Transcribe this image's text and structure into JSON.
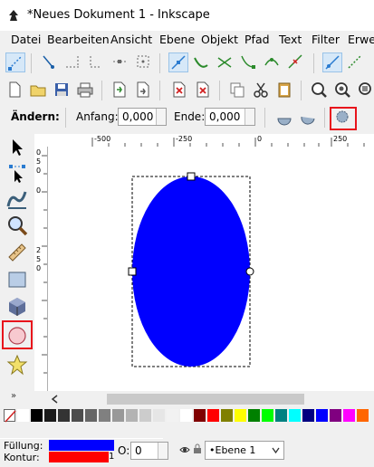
{
  "window": {
    "title": "*Neues Dokument 1 - Inkscape"
  },
  "menu": [
    "Datei",
    "Bearbeiten",
    "Ansicht",
    "Ebene",
    "Objekt",
    "Pfad",
    "Text",
    "Filter",
    "Erwei"
  ],
  "controls": {
    "label_edit": "Ändern:",
    "label_start": "Anfang:",
    "start_value": "0,000",
    "label_end": "Ende:",
    "end_value": "0,000"
  },
  "ruler": {
    "top_labels": [
      "-500",
      "-250",
      "0",
      "250"
    ],
    "left_labels": [
      "0",
      "5",
      "0",
      "0",
      "2",
      "5",
      "0"
    ]
  },
  "toolbox": [
    "selector-tool",
    "node-tool",
    "tweak-tool",
    "zoom-tool",
    "measure-tool",
    "rect-tool",
    "3dbox-tool",
    "ellipse-tool",
    "star-tool"
  ],
  "palette_colors": [
    "#ffffff",
    "#000000",
    "#1a1a1a",
    "#333333",
    "#4d4d4d",
    "#666666",
    "#808080",
    "#999999",
    "#b3b3b3",
    "#cccccc",
    "#e6e6e6",
    "#f2f2f2",
    "#ffffff",
    "#800000",
    "#ff0000",
    "#808000",
    "#ffff00",
    "#008000",
    "#00ff00",
    "#008080",
    "#00ffff",
    "#000080",
    "#0000ff",
    "#800080",
    "#ff00ff",
    "#ff6600"
  ],
  "status": {
    "fill_label": "Füllung:",
    "stroke_label": "Kontur:",
    "fill_color": "#0000ff",
    "stroke_color": "#ff0000",
    "stroke_width": "1",
    "opacity_label": "O:",
    "opacity_value": "0",
    "layer_name": "•Ebene 1"
  },
  "colors": {
    "highlight": "#e8141c",
    "ellipse": "#0000ff"
  }
}
